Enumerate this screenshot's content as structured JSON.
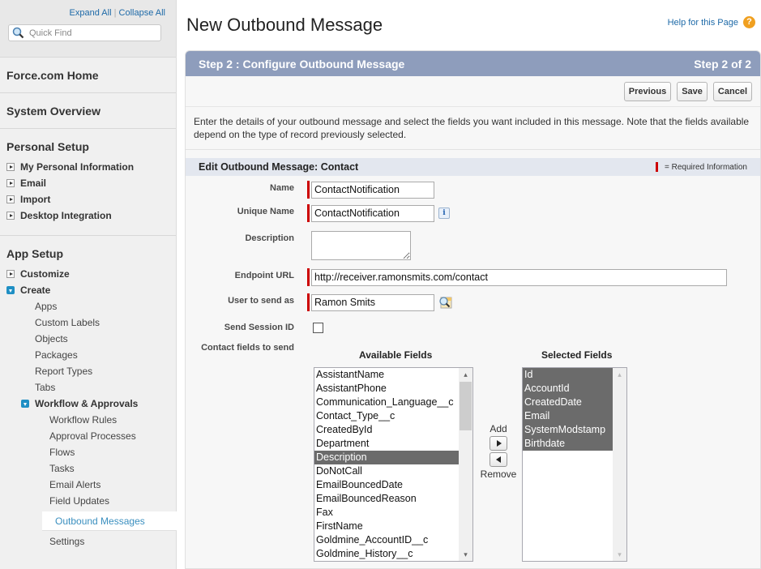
{
  "sidebar": {
    "expand_all": "Expand All",
    "separator": "|",
    "collapse_all": "Collapse All",
    "quick_find_placeholder": "Quick Find",
    "force_home": "Force.com Home",
    "system_overview": "System Overview",
    "personal_setup": {
      "title": "Personal Setup",
      "items": [
        "My Personal Information",
        "Email",
        "Import",
        "Desktop Integration"
      ]
    },
    "app_setup": {
      "title": "App Setup",
      "customize": "Customize",
      "create": "Create",
      "create_items": [
        "Apps",
        "Custom Labels",
        "Objects",
        "Packages",
        "Report Types",
        "Tabs"
      ],
      "workflow": "Workflow & Approvals",
      "workflow_items": [
        "Workflow Rules",
        "Approval Processes",
        "Flows",
        "Tasks",
        "Email Alerts",
        "Field Updates"
      ],
      "active_item": "Outbound Messages",
      "settings": "Settings"
    }
  },
  "header": {
    "title": "New Outbound Message",
    "help_link": "Help for this Page",
    "help_icon": "?"
  },
  "wizard": {
    "step_title": "Step 2 : Configure Outbound Message",
    "step_counter": "Step 2 of 2",
    "buttons": {
      "previous": "Previous",
      "save": "Save",
      "cancel": "Cancel"
    },
    "description": "Enter the details of your outbound message and select the fields you want included in this message. Note that the fields available depend on the type of record previously selected."
  },
  "section": {
    "title": "Edit Outbound Message: Contact",
    "required_legend": "= Required Information"
  },
  "form": {
    "name": {
      "label": "Name",
      "value": "ContactNotification"
    },
    "unique_name": {
      "label": "Unique Name",
      "value": "ContactNotification",
      "info_icon": "i"
    },
    "description": {
      "label": "Description",
      "value": ""
    },
    "endpoint_url": {
      "label": "Endpoint URL",
      "value": "http://receiver.ramonsmits.com/contact"
    },
    "user_to_send_as": {
      "label": "User to send as",
      "value": "Ramon Smits"
    },
    "send_session_id": {
      "label": "Send Session ID",
      "checked": false
    },
    "fields_to_send": {
      "label": "Contact fields to send"
    }
  },
  "picklist": {
    "available_title": "Available Fields",
    "selected_title": "Selected Fields",
    "add_label": "Add",
    "remove_label": "Remove",
    "available": [
      {
        "label": "AssistantName",
        "selected": false
      },
      {
        "label": "AssistantPhone",
        "selected": false
      },
      {
        "label": "Communication_Language__c",
        "selected": false
      },
      {
        "label": "Contact_Type__c",
        "selected": false
      },
      {
        "label": "CreatedById",
        "selected": false
      },
      {
        "label": "Department",
        "selected": false
      },
      {
        "label": "Description",
        "selected": true
      },
      {
        "label": "DoNotCall",
        "selected": false
      },
      {
        "label": "EmailBouncedDate",
        "selected": false
      },
      {
        "label": "EmailBouncedReason",
        "selected": false
      },
      {
        "label": "Fax",
        "selected": false
      },
      {
        "label": "FirstName",
        "selected": false
      },
      {
        "label": "Goldmine_AccountID__c",
        "selected": false
      },
      {
        "label": "Goldmine_History__c",
        "selected": false
      }
    ],
    "selected": [
      {
        "label": "Id",
        "selected": true
      },
      {
        "label": "AccountId",
        "selected": true
      },
      {
        "label": "CreatedDate",
        "selected": true
      },
      {
        "label": "Email",
        "selected": true
      },
      {
        "label": "SystemModstamp",
        "selected": true
      },
      {
        "label": "Birthdate",
        "selected": true
      }
    ]
  },
  "colors": {
    "step_header": "#8e9dbc",
    "required": "#cc0000",
    "link": "#1e6aa8",
    "active_nav": "#3a8fbf",
    "selected_option": "#6b6b6b"
  }
}
